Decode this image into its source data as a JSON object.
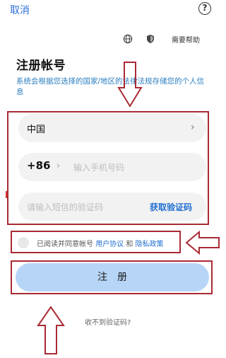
{
  "header": {
    "cancel_label": "取消",
    "help_icon": "question-circle-icon",
    "globe_icon": "globe-icon",
    "shield_icon": "shield-icon",
    "help_link_label": "需要帮助"
  },
  "title": "注册帐号",
  "description": "系统会根据您选择的国家/地区的法律法规存储您的个人信息",
  "form": {
    "country_value": "中国",
    "country_chevron_icon": "chevron-right-icon",
    "phone_code": "+86",
    "phone_code_chevron_icon": "chevron-right-icon",
    "phone_placeholder": "输入手机号码",
    "sms_placeholder": "请输入短信的验证码",
    "get_code_label": "获取验证码"
  },
  "agreement": {
    "prefix": "已阅读并同意帐号 ",
    "user_agreement": "用户协议",
    "conjunction": " 和 ",
    "privacy_policy": "隐私政策"
  },
  "register_label": "注册",
  "no_code_label": "收不到验证码?",
  "annotation": {
    "frame_color": "#a92a35",
    "arrow_icons": [
      "down-arrow-annotation",
      "left-arrow-annotation",
      "up-arrow-annotation"
    ]
  },
  "colors": {
    "accent": "#1f6fd0",
    "button_bg": "#b7d5f7",
    "field_bg": "#f2f2f2"
  }
}
